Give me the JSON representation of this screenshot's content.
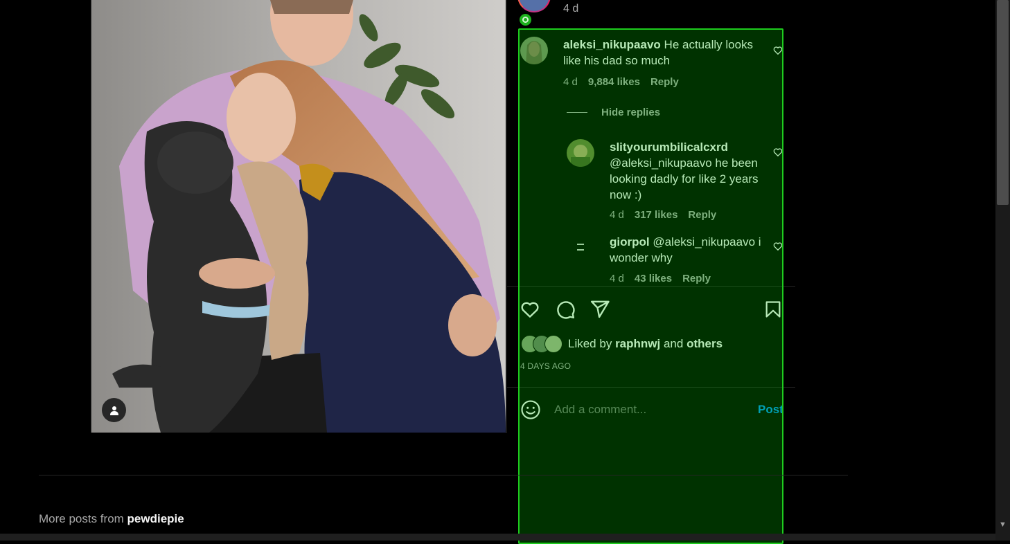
{
  "post": {
    "time_top": "4 d",
    "liked_by_prefix": "Liked by",
    "liked_by_user": "raphnwj",
    "liked_by_and": "and",
    "liked_by_others": "others",
    "date": "4 DAYS AGO"
  },
  "comments": [
    {
      "username": "aleksi_nikupaavo",
      "text": "He actually looks like his dad so much",
      "time": "4 d",
      "likes": "9,884 likes",
      "reply": "Reply"
    }
  ],
  "hide_replies": "Hide replies",
  "replies": [
    {
      "username": "slityourumbilicalcxrd",
      "text": "@aleksi_nikupaavo he been looking dadly for like 2 years now :)",
      "time": "4 d",
      "likes": "317 likes",
      "reply": "Reply"
    },
    {
      "username": "giorpol",
      "text": "@aleksi_nikupaavo i wonder why",
      "time": "4 d",
      "likes": "43 likes",
      "reply": "Reply"
    }
  ],
  "add_comment": {
    "placeholder": "Add a comment...",
    "post_label": "Post"
  },
  "more_posts": {
    "prefix": "More posts from",
    "user": "pewdiepie"
  },
  "colors": {
    "background": "#000000",
    "link_blue": "#0095f6",
    "muted": "#a8a8a8",
    "highlight": "#1ecb1e"
  },
  "icons": [
    "heart-icon",
    "comment-icon",
    "share-icon",
    "bookmark-icon",
    "emoji-icon",
    "user-tag-icon",
    "verified-ring-icon"
  ]
}
